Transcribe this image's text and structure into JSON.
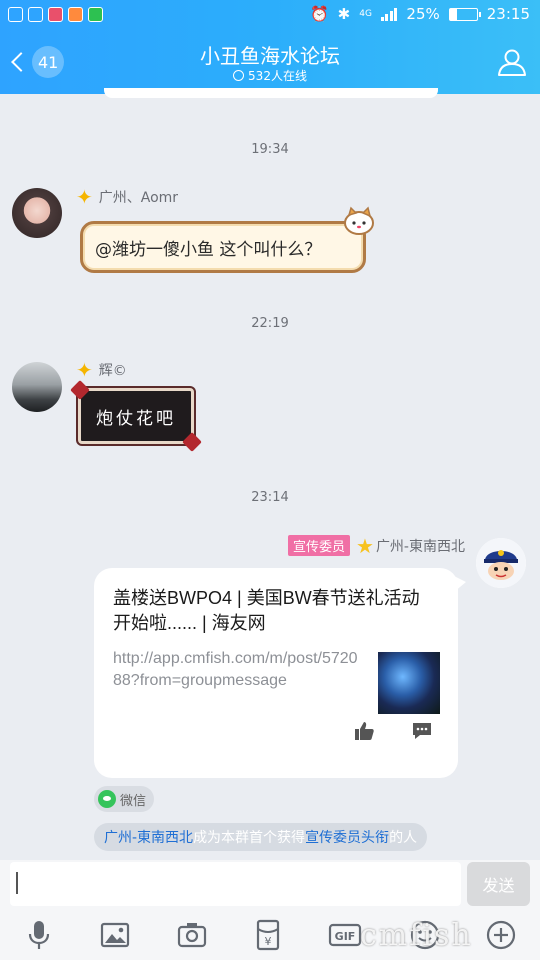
{
  "status_bar": {
    "battery": "25%",
    "battery_level": 0.25,
    "time": "23:15",
    "network": "4G"
  },
  "header": {
    "back_count": "41",
    "title": "小丑鱼海水论坛",
    "online": "532人在线"
  },
  "messages": [
    {
      "time": "19:34",
      "sender": "广州、Aomr",
      "content": "@潍坊一傻小鱼 这个叫什么？"
    },
    {
      "time": "22:19",
      "sender": "辉©",
      "content": "炮仗花吧"
    },
    {
      "time": "23:14",
      "role_tag": "宣传委员",
      "sender": "广州-東南西北",
      "card": {
        "title": "盖楼送BWPO4 | 美国BW春节送礼活动开始啦...... | 海友网",
        "url": "http://app.cmfish.com/m/post/572088?from=groupmessage"
      },
      "source": "微信"
    }
  ],
  "system_notice": {
    "part1": "广州-東南西北",
    "part2": "成为本群首个获得",
    "part3": "宣传委员头衔",
    "part4": "的人"
  },
  "input": {
    "value": "",
    "send_label": "发送"
  },
  "toolbar": {
    "icons": [
      "microphone-icon",
      "image-icon",
      "camera-icon",
      "red-packet-icon",
      "gif-icon",
      "emoji-icon",
      "plus-icon"
    ]
  },
  "watermark": "cmfish"
}
